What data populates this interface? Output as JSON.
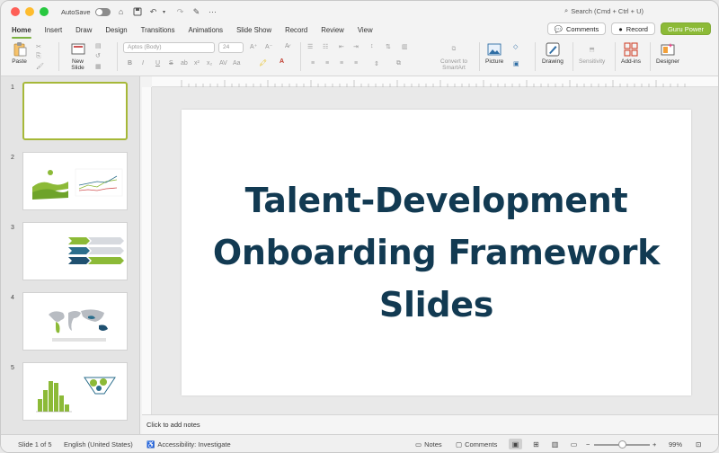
{
  "titlebar": {
    "autosave_label": "AutoSave",
    "search_placeholder": "Search (Cmd + Ctrl + U)"
  },
  "tabs": [
    {
      "label": "Home",
      "active": true
    },
    {
      "label": "Insert"
    },
    {
      "label": "Draw"
    },
    {
      "label": "Design"
    },
    {
      "label": "Transitions"
    },
    {
      "label": "Animations"
    },
    {
      "label": "Slide Show"
    },
    {
      "label": "Record"
    },
    {
      "label": "Review"
    },
    {
      "label": "View"
    }
  ],
  "tab_right": {
    "comments_label": "Comments",
    "record_label": "Record",
    "guru_label": "Guru Power"
  },
  "ribbon": {
    "paste_label": "Paste",
    "new_slide_label": "New\nSlide",
    "font_name": "Aptos (Body)",
    "font_size": "24",
    "convert_label": "Convert to\nSmartArt",
    "picture_label": "Picture",
    "drawing_label": "Drawing",
    "sensitivity_label": "Sensitivity",
    "addins_label": "Add-ins",
    "designer_label": "Designer",
    "format_buttons": [
      "B",
      "I",
      "U",
      "S",
      "ab",
      "x²",
      "x₂",
      "AV",
      "Aa"
    ]
  },
  "thumbnails": [
    {
      "number": "1",
      "selected": true
    },
    {
      "number": "2"
    },
    {
      "number": "3"
    },
    {
      "number": "4"
    },
    {
      "number": "5"
    }
  ],
  "slide": {
    "title_line1": "Talent-Development",
    "title_line2": "Onboarding Framework",
    "title_line3": "Slides",
    "title_color": "#123a52"
  },
  "notes_placeholder": "Click to add notes",
  "status": {
    "slide_indicator": "Slide 1 of 5",
    "language": "English (United States)",
    "accessibility": "Accessibility: Investigate",
    "notes_label": "Notes",
    "comments_label": "Comments",
    "zoom_level": "99%"
  },
  "colors": {
    "accent_green": "#8cba37",
    "dark_blue": "#123a52",
    "teal": "#2b6e8c"
  }
}
